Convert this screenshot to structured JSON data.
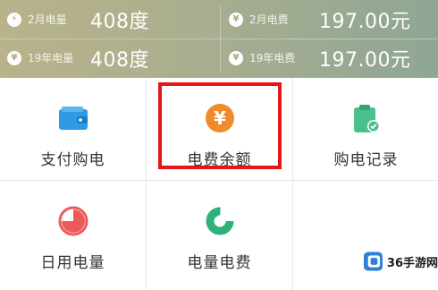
{
  "stats": [
    {
      "icon": "lightning-icon",
      "label": "2月电量",
      "value": "408度"
    },
    {
      "icon": "yen-icon",
      "label": "2月电费",
      "value": "197.00元"
    },
    {
      "icon": "yen-icon",
      "label": "19年电量",
      "value": "408度"
    },
    {
      "icon": "money-bag-icon",
      "label": "19年电费",
      "value": "197.00元"
    }
  ],
  "tiles": [
    {
      "label": "支付购电",
      "icon": "wallet-icon"
    },
    {
      "label": "电费余额",
      "icon": "yen-coin-icon",
      "highlighted": true
    },
    {
      "label": "购电记录",
      "icon": "clipboard-check-icon"
    },
    {
      "label": "日用电量",
      "icon": "pie-chart-icon"
    },
    {
      "label": "电量电费",
      "icon": "donut-chart-icon"
    }
  ],
  "watermark": {
    "text": "36手游网"
  },
  "colors": {
    "header_start": "#b9b38a",
    "header_end": "#8fa694",
    "highlight_border": "#e01818",
    "wallet_blue": "#2f9be6",
    "coin_orange": "#f08a2a",
    "clipboard_green": "#4cbf8e",
    "pie_red": "#ec5a5a",
    "donut_green": "#2fb27a"
  }
}
